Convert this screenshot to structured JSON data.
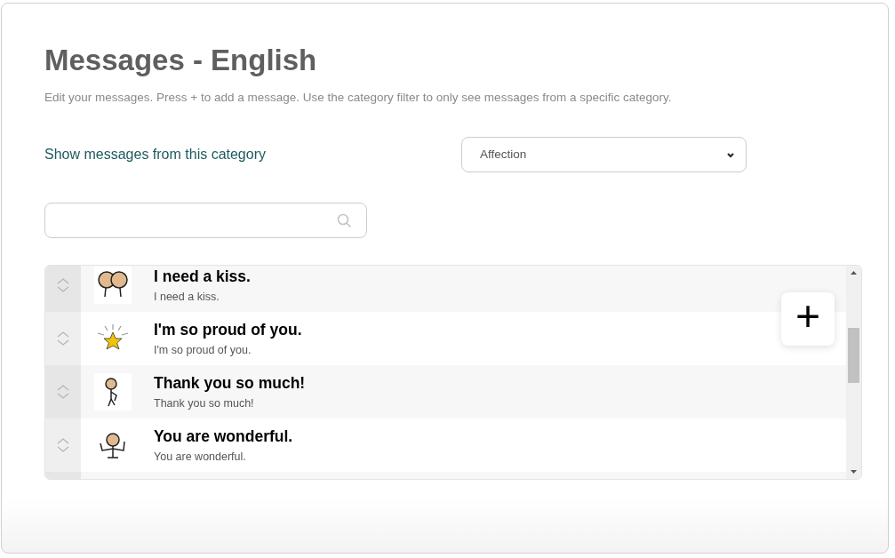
{
  "title": "Messages - English",
  "description": "Edit your messages. Press + to add a message. Use the category filter to only see messages from a specific category.",
  "filter": {
    "label": "Show messages from this category",
    "value": "Affection"
  },
  "messages": [
    {
      "kind": "kiss",
      "title": "I need a kiss.",
      "subtitle": "I need a kiss."
    },
    {
      "kind": "star",
      "title": "I'm so proud of you.",
      "subtitle": "I'm so proud of you."
    },
    {
      "kind": "thanks",
      "title": "Thank you so much!",
      "subtitle": "Thank you so much!"
    },
    {
      "kind": "cheer",
      "title": "You are wonderful.",
      "subtitle": "You are wonderful."
    }
  ],
  "add_button": "+"
}
